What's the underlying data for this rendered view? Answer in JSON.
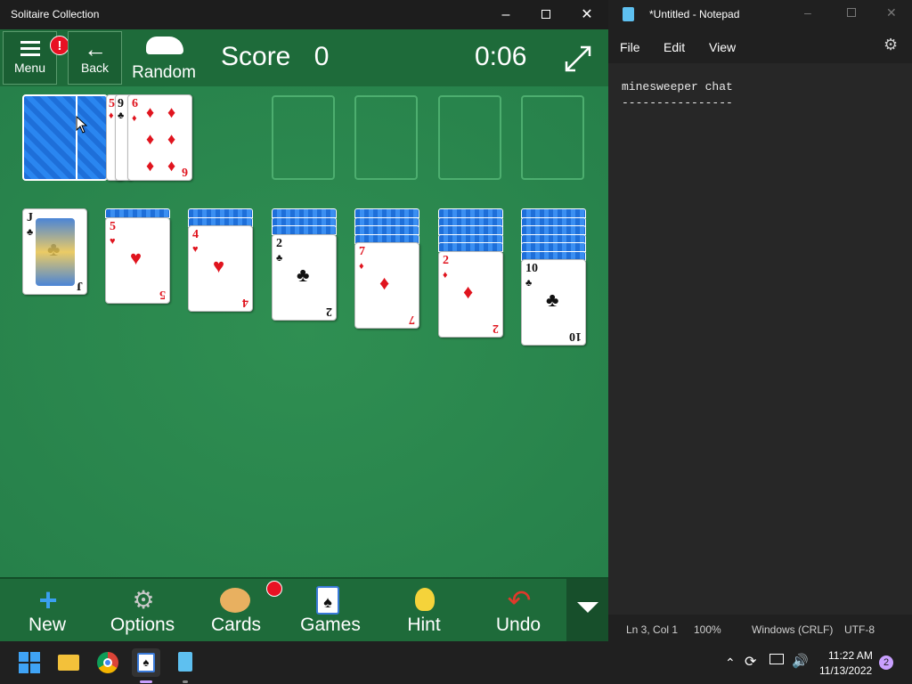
{
  "solitaire": {
    "window_title": "Solitaire Collection",
    "menu_label": "Menu",
    "menu_badge": "!",
    "back_label": "Back",
    "mode_label": "Random",
    "score_label": "Score",
    "score_value": "0",
    "timer": "0:06",
    "waste_cards": [
      {
        "rank": "5",
        "suit": "♦",
        "color": "red"
      },
      {
        "rank": "9",
        "suit": "♣",
        "color": "black"
      },
      {
        "rank": "6",
        "suit": "♦",
        "color": "red"
      }
    ],
    "tableau": [
      {
        "rank": "J",
        "suit": "♣",
        "color": "black",
        "face_down": 0
      },
      {
        "rank": "5",
        "suit": "♥",
        "color": "red",
        "face_down": 1
      },
      {
        "rank": "4",
        "suit": "♥",
        "color": "red",
        "face_down": 2
      },
      {
        "rank": "2",
        "suit": "♣",
        "color": "black",
        "face_down": 3
      },
      {
        "rank": "7",
        "suit": "♦",
        "color": "red",
        "face_down": 4
      },
      {
        "rank": "2",
        "suit": "♦",
        "color": "red",
        "face_down": 5
      },
      {
        "rank": "10",
        "suit": "♣",
        "color": "black",
        "face_down": 6
      }
    ],
    "toolbar": {
      "new_label": "New",
      "options_label": "Options",
      "cards_label": "Cards",
      "games_label": "Games",
      "hint_label": "Hint",
      "undo_label": "Undo"
    }
  },
  "notepad": {
    "window_title": "*Untitled - Notepad",
    "menu": {
      "file": "File",
      "edit": "Edit",
      "view": "View"
    },
    "content_line1": "minesweeper chat",
    "content_line2": "----------------",
    "status": {
      "position": "Ln 3, Col 1",
      "zoom": "100%",
      "line_ending": "Windows (CRLF)",
      "encoding": "UTF-8"
    }
  },
  "taskbar": {
    "time": "11:22 AM",
    "date": "11/13/2022",
    "notification_count": "2"
  },
  "colors": {
    "felt": "#2f8a4f",
    "toolbar": "#1e6b3a",
    "card_back": "#1e6fd9",
    "red_suit": "#e0141e"
  }
}
